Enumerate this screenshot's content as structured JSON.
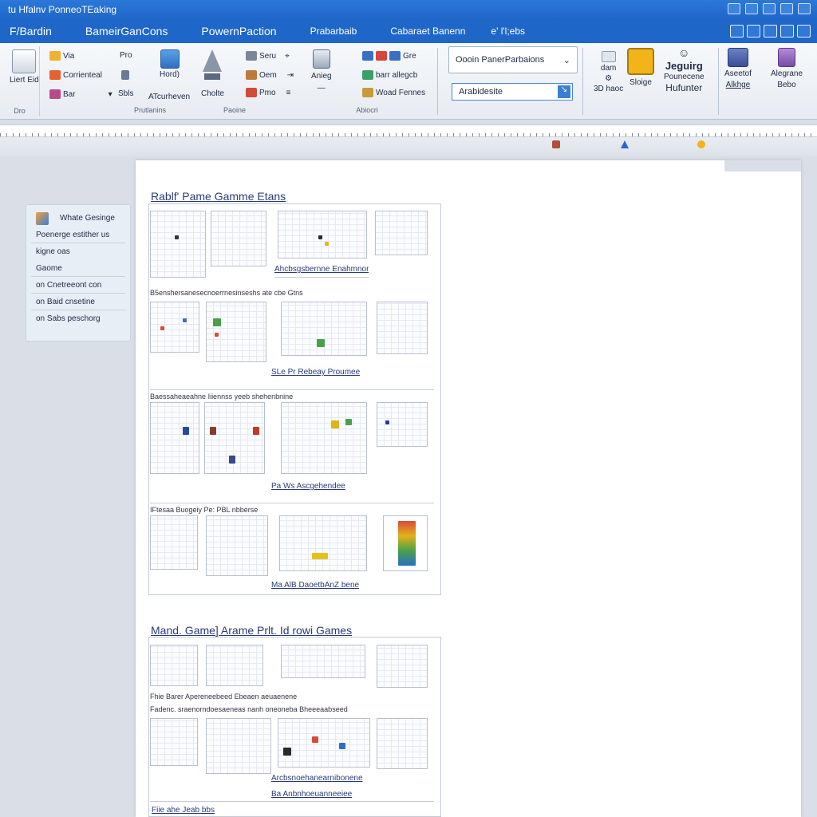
{
  "window": {
    "title": "tu Hfalnv PonneoTEaking"
  },
  "tabs": [
    "F/Bardin",
    "BameirGanCons",
    "PowernPaction",
    "Prabarbaib",
    "Cabaraet Banenn",
    "e' l'l;ebs"
  ],
  "ribbon": {
    "col1_big": "Liert Eid",
    "col1_small": "Dro",
    "col2": [
      "Via",
      "Corrienteal",
      "Bar"
    ],
    "col3": [
      "Pro",
      "Sbls"
    ],
    "col4": [
      "Hord)",
      "ATcurheven"
    ],
    "col5": "Cholte",
    "col6": [
      "Seru",
      "Oem",
      "Pmo"
    ],
    "col7": "Anieg",
    "col8": [
      "Gre",
      "barr allegcb",
      "Woad Fennes"
    ],
    "group_labels": [
      "Prutlanins",
      "Paoine",
      "Abiocri"
    ],
    "dropdown1": "Oooin PanerParbaions",
    "dropdown2": "Arabidesite",
    "col9": [
      "dam",
      "Sloige",
      "3D haoc"
    ],
    "col10": [
      "Jeguirg",
      "Pounecene",
      "Hufunter"
    ],
    "col11": [
      "Aseetof",
      "Alkhge"
    ],
    "col12": [
      "Alegrane",
      "Bebo"
    ]
  },
  "nav": {
    "items": [
      "Whate Gesinge",
      "Poenerge estither us",
      "kigne oas",
      "Gaome",
      "Cnetreeont con",
      "Baid cnsetine",
      "Sabs peschorg"
    ],
    "markers": [
      "on",
      "on",
      "on"
    ]
  },
  "sections": [
    {
      "heading": "Rablf' Pame Gamme Etans",
      "rows": [
        {
          "caption": "Ahcbsgsbernne Enahmnonab",
          "label": ""
        },
        {
          "caption": "SLe Pr Rebeay Proumee",
          "label": "B5enshersanesecnoerrnesinseshs ate cbe Gtns"
        },
        {
          "caption": "Pa Ws Ascgehendee",
          "label": "Baessaheaeahne  Iiiennss  yeeb  shehenbnine"
        },
        {
          "caption": "Ma AlB DaoetbAnZ bene",
          "label": "IFtesaa  Buogeiy       Pe: PBL  nbberse"
        }
      ]
    },
    {
      "heading": "Mand. Game] Arame Prlt. Id rowi Games",
      "rows": [
        {
          "caption": "",
          "label": "Fhie Barer  Apereneebeed Ebeaen aeuaenene"
        },
        {
          "caption": "Arcbsnoehanearnibonene",
          "label": "Fadenc. sraenorndoesaeneas  nanh oneoneba  Bheeeaabseed"
        },
        {
          "caption": "Ba Anbnhoeuanneeiee",
          "label": ""
        }
      ],
      "footer_label": "Fiie ahe Jeab bbs"
    }
  ],
  "colors": {
    "brand": "#1f66c9",
    "heading": "#2a3a7a"
  }
}
